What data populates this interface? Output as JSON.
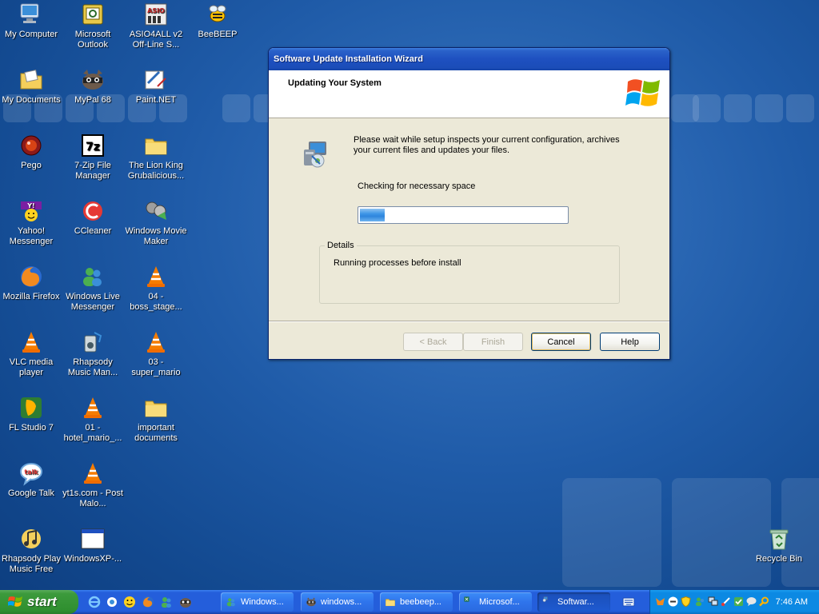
{
  "desktop": {
    "icons": [
      {
        "label": "My Computer",
        "icon": "my-computer-icon"
      },
      {
        "label": "Microsoft Outlook",
        "icon": "outlook-icon"
      },
      {
        "label": "ASIO4ALL v2 Off-Line S...",
        "icon": "asio-icon"
      },
      {
        "label": "BeeBEEP",
        "icon": "beebeep-icon"
      },
      {
        "label": "My Documents",
        "icon": "my-documents-icon"
      },
      {
        "label": "MyPal 68",
        "icon": "mypal-icon"
      },
      {
        "label": "Paint.NET",
        "icon": "paint-net-icon"
      },
      {
        "label": "Pego",
        "icon": "pego-icon"
      },
      {
        "label": "7-Zip File Manager",
        "icon": "seven-zip-icon"
      },
      {
        "label": "The Lion King Grubalicious...",
        "icon": "folder-icon"
      },
      {
        "label": "Yahoo! Messenger",
        "icon": "yahoo-icon"
      },
      {
        "label": "CCleaner",
        "icon": "ccleaner-icon"
      },
      {
        "label": "Windows Movie Maker",
        "icon": "movie-maker-icon"
      },
      {
        "label": "Mozilla Firefox",
        "icon": "firefox-icon"
      },
      {
        "label": "Windows Live Messenger",
        "icon": "live-messenger-icon"
      },
      {
        "label": "04 - boss_stage...",
        "icon": "vlc-icon"
      },
      {
        "label": "VLC media player",
        "icon": "vlc-icon"
      },
      {
        "label": "Rhapsody Music Man...",
        "icon": "rhapsody-icon"
      },
      {
        "label": "03 - super_mario",
        "icon": "vlc-icon"
      },
      {
        "label": "FL Studio 7",
        "icon": "fl-studio-icon"
      },
      {
        "label": "01 - hotel_mario_...",
        "icon": "vlc-icon"
      },
      {
        "label": "important documents",
        "icon": "folder-icon"
      },
      {
        "label": "Google Talk",
        "icon": "google-talk-icon"
      },
      {
        "label": "yt1s.com - Post Malo...",
        "icon": "vlc-icon"
      },
      {
        "label": "Rhapsody Play Music Free",
        "icon": "rhapsody-play-icon"
      },
      {
        "label": "WindowsXP-...",
        "icon": "window-app-icon"
      },
      {
        "label": "Recycle Bin",
        "icon": "recycle-bin-icon"
      }
    ]
  },
  "wizard": {
    "title": "Software Update Installation Wizard",
    "heading": "Updating Your System",
    "message": "Please wait while setup inspects your current configuration, archives your current files and updates your files.",
    "status": "Checking for necessary space",
    "progress_fraction": 0.12,
    "details_legend": "Details",
    "details_text": "Running processes before install",
    "buttons": {
      "back": "< Back",
      "finish": "Finish",
      "cancel": "Cancel",
      "help": "Help"
    }
  },
  "taskbar": {
    "start_label": "start",
    "tasks": [
      {
        "label": "Windows...",
        "icon": "live-messenger-icon"
      },
      {
        "label": "windows...",
        "icon": "mypal-icon"
      },
      {
        "label": "beebeep...",
        "icon": "folder-icon"
      },
      {
        "label": "Microsof...",
        "icon": "excel-icon"
      },
      {
        "label": "Softwar...",
        "icon": "setup-icon"
      }
    ],
    "clock": "7:46 AM"
  },
  "colors": {
    "title_bar": "#1e50c0",
    "taskbar": "#245edb",
    "start_button": "#3c9a3c",
    "tray": "#0c89e3",
    "progress_fill": "#3d95e6"
  }
}
